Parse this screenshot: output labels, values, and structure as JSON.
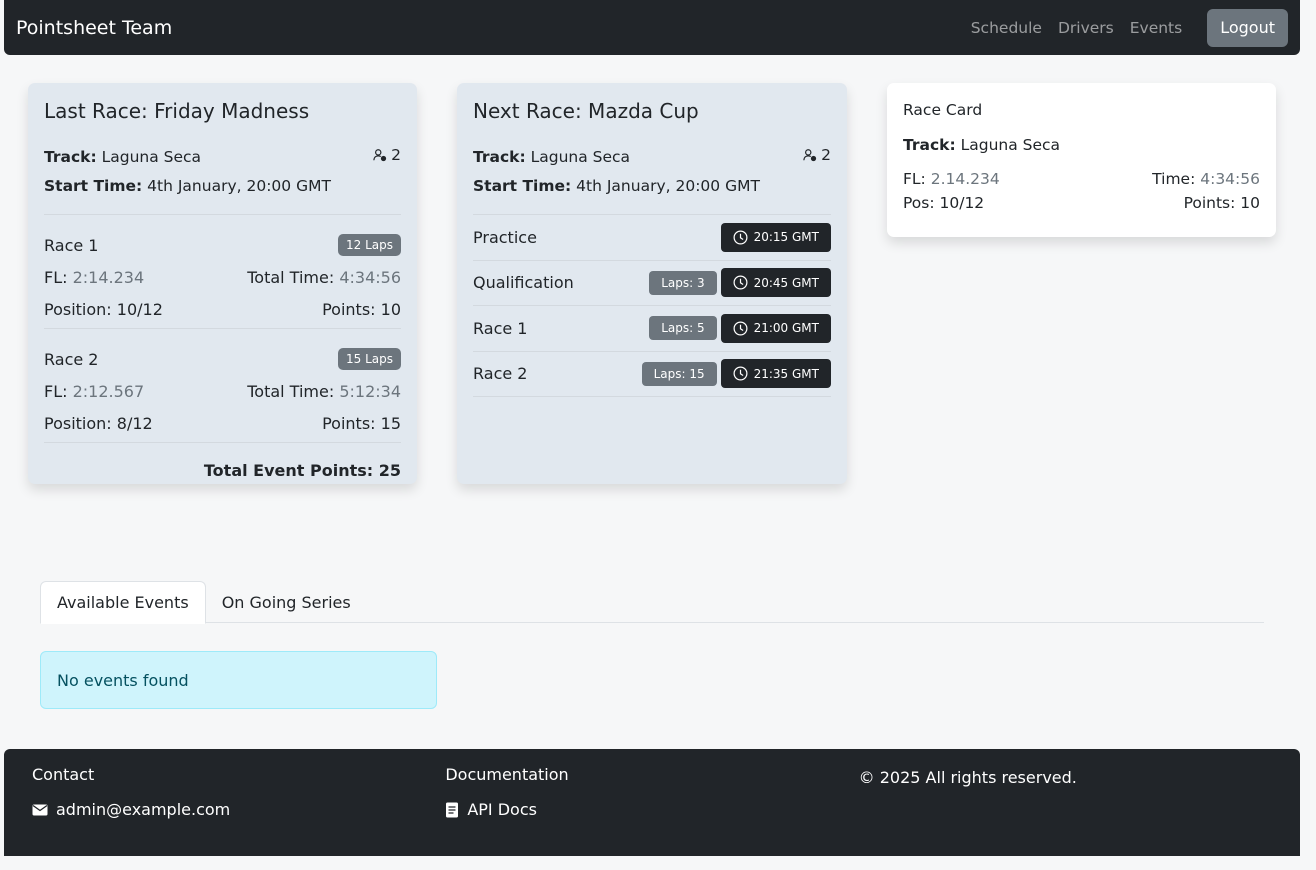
{
  "navbar": {
    "brand": "Pointsheet Team",
    "links": [
      "Schedule",
      "Drivers",
      "Events"
    ],
    "logout": "Logout"
  },
  "last_race": {
    "title": "Last Race: Friday Madness",
    "track_label": "Track:",
    "track": "Laguna Seca",
    "start_label": "Start Time:",
    "start": "4th January, 20:00 GMT",
    "drivers": "2",
    "races": [
      {
        "name": "Race 1",
        "laps": "12 Laps",
        "fl_label": "FL:",
        "fl": "2:14.234",
        "tt_label": "Total Time:",
        "tt": "4:34:56",
        "position": "Position: 10/12",
        "points": "Points: 10"
      },
      {
        "name": "Race 2",
        "laps": "15 Laps",
        "fl_label": "FL:",
        "fl": "2:12.567",
        "tt_label": "Total Time:",
        "tt": "5:12:34",
        "position": "Position: 8/12",
        "points": "Points: 15"
      }
    ],
    "total": "Total Event Points: 25"
  },
  "next_race": {
    "title": "Next Race: Mazda Cup",
    "track_label": "Track:",
    "track": "Laguna Seca",
    "start_label": "Start Time:",
    "start": "4th January, 20:00 GMT",
    "drivers": "2",
    "sessions": [
      {
        "name": "Practice",
        "laps": "",
        "time": "20:15 GMT"
      },
      {
        "name": "Qualification",
        "laps": "Laps: 3",
        "time": "20:45 GMT"
      },
      {
        "name": "Race 1",
        "laps": "Laps: 5",
        "time": "21:00 GMT"
      },
      {
        "name": "Race 2",
        "laps": "Laps: 15",
        "time": "21:35 GMT"
      }
    ]
  },
  "race_card": {
    "title": "Race Card",
    "track_label": "Track:",
    "track": "Laguna Seca",
    "fl_label": "FL:",
    "fl": "2.14.234",
    "time_label": "Time:",
    "time": "4:34:56",
    "pos": "Pos: 10/12",
    "points": "Points: 10"
  },
  "tabs": [
    "Available Events",
    "On Going Series"
  ],
  "alert": "No events found",
  "footer": {
    "contact_title": "Contact",
    "email": "admin@example.com",
    "docs_title": "Documentation",
    "api_docs": "API Docs",
    "copyright": "© 2025 All rights reserved."
  }
}
